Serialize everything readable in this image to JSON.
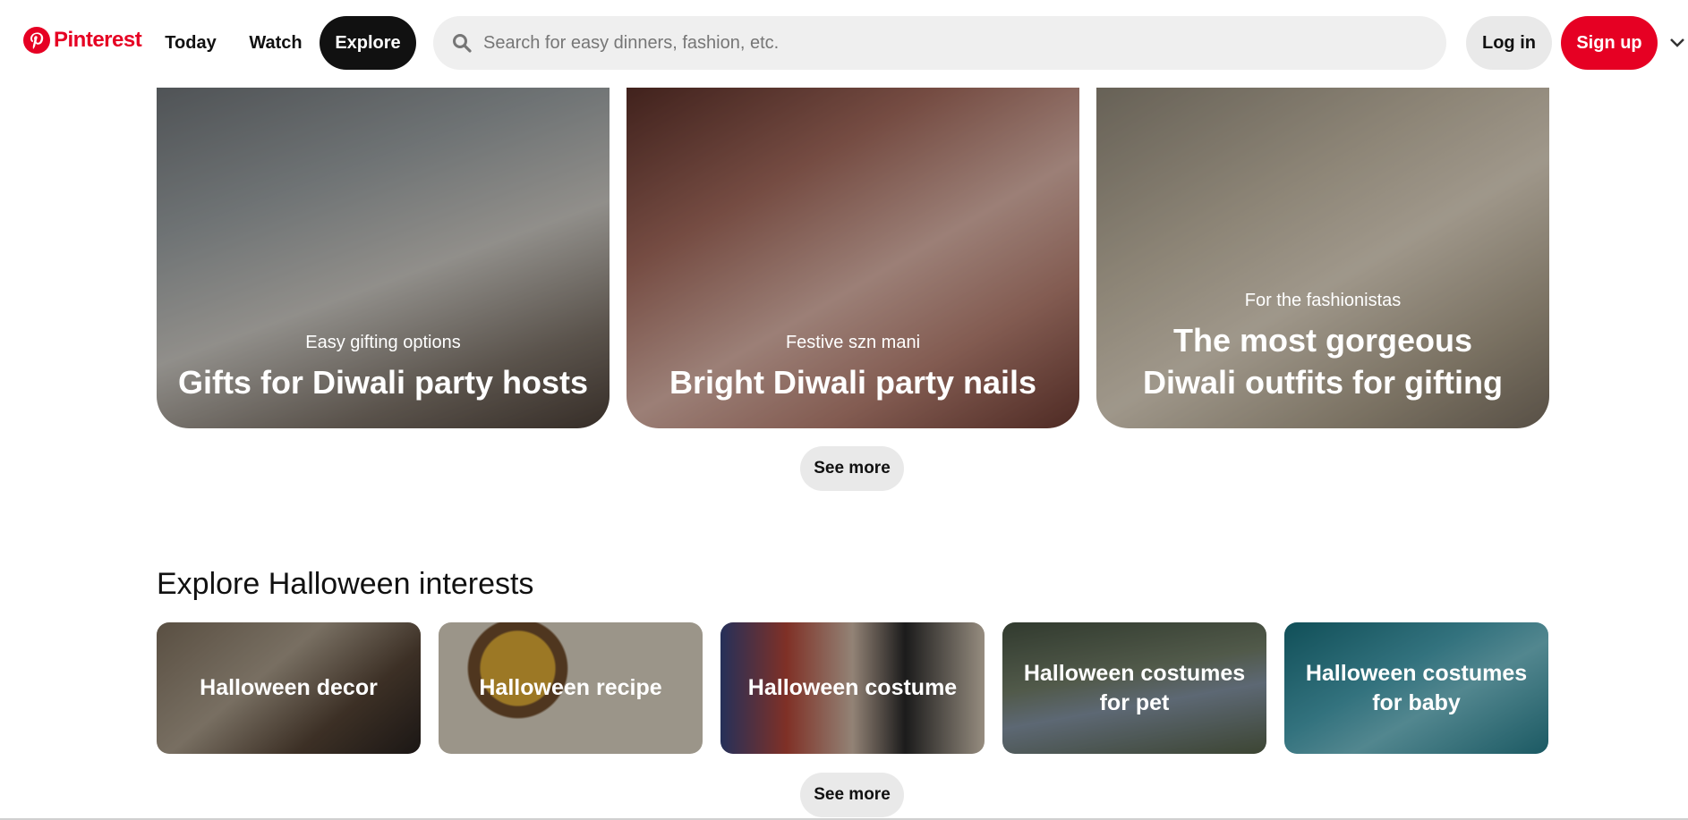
{
  "header": {
    "brand": "Pinterest",
    "nav": {
      "today": "Today",
      "watch": "Watch",
      "explore": "Explore"
    },
    "search": {
      "placeholder": "Search for easy dinners, fashion, etc."
    },
    "login_label": "Log in",
    "signup_label": "Sign up",
    "brand_color": "#e60023"
  },
  "featured": {
    "cards": [
      {
        "subtitle": "Easy gifting options",
        "title": "Gifts for Diwali party hosts"
      },
      {
        "subtitle": "Festive szn mani",
        "title": "Bright Diwali party nails"
      },
      {
        "subtitle": "For the fashionistas",
        "title": "The most gorgeous Diwali outfits for gifting"
      }
    ],
    "see_more": "See more"
  },
  "halloween": {
    "heading": "Explore Halloween interests",
    "cards": [
      {
        "label": "Halloween decor"
      },
      {
        "label": "Halloween recipe"
      },
      {
        "label": "Halloween costume"
      },
      {
        "label": "Halloween costumes for pet"
      },
      {
        "label": "Halloween costumes for baby"
      }
    ],
    "see_more": "See more"
  }
}
